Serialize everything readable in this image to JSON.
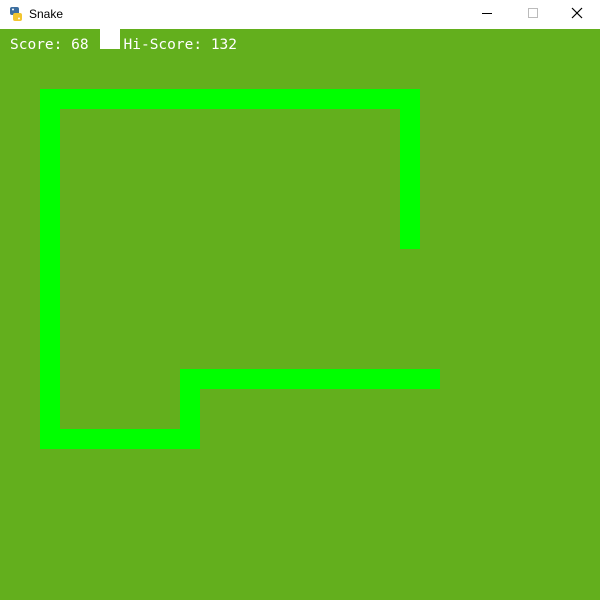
{
  "window": {
    "title": "Snake",
    "icons": {
      "app": "python-snake-icon",
      "minimize": "minimize-icon",
      "maximize": "maximize-icon",
      "close": "close-icon"
    }
  },
  "hud": {
    "score_label": "Score:",
    "score": 68,
    "hiscore_label": "Hi-Score:",
    "hiscore": 132
  },
  "colors": {
    "background": "#63af1d",
    "snake": "#00ff00",
    "food": "#ffffff",
    "text": "#ffffff"
  },
  "grid": {
    "cell_units": 20
  },
  "snake": {
    "direction": "right",
    "path": [
      [
        20,
        10
      ],
      [
        20,
        3
      ],
      [
        2,
        3
      ],
      [
        2,
        20
      ],
      [
        9,
        20
      ],
      [
        9,
        17
      ],
      [
        21,
        17
      ]
    ]
  },
  "food": {
    "cell": [
      5,
      0
    ]
  }
}
